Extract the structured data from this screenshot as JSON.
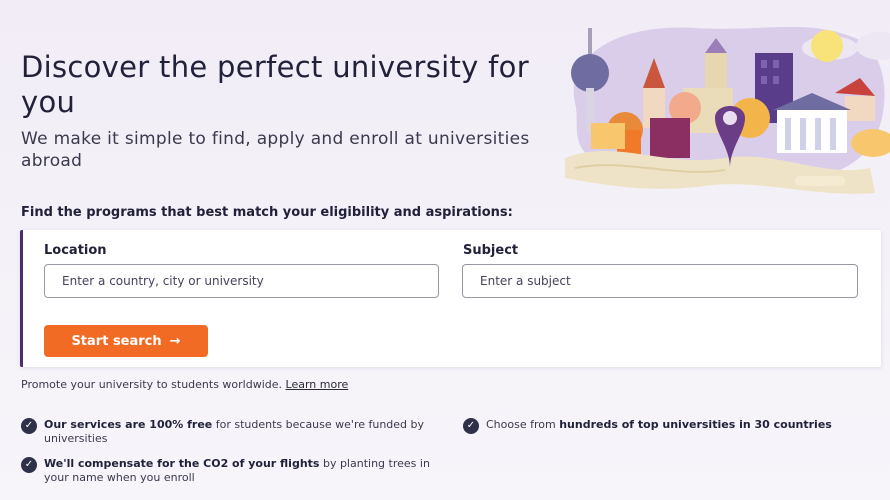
{
  "hero": {
    "title": "Discover the perfect university for you",
    "subtitle": "We make it simple to find, apply and enroll at universities abroad"
  },
  "search": {
    "intro": "Find the programs that best match your eligibility and aspirations:",
    "location_label": "Location",
    "location_placeholder": "Enter a country, city or university",
    "subject_label": "Subject",
    "subject_placeholder": "Enter a subject",
    "button_label": "Start search",
    "button_icon": "arrow-right-icon",
    "accent_color": "#f26b25",
    "card_border_color": "#4c2c6e"
  },
  "promote": {
    "text": "Promote your university to students worldwide.",
    "link": "Learn more"
  },
  "benefits": [
    {
      "bold": "Our services are 100% free",
      "rest": " for students because we're funded by universities"
    },
    {
      "bold": "We'll compensate for the CO2 of your flights",
      "rest": " by planting trees in your name when you enroll"
    },
    {
      "pre": "Choose from ",
      "bold": "hundreds of top universities in 30 countries"
    }
  ],
  "icons": [
    "check-circle-icon",
    "arrow-right-icon",
    "city-illustration"
  ]
}
